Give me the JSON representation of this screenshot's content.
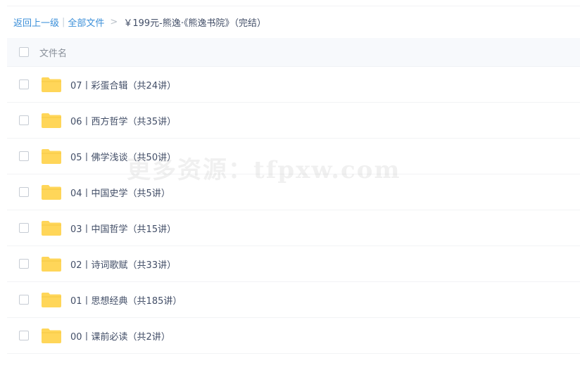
{
  "breadcrumb": {
    "back": "返回上一级",
    "divider": "|",
    "all_files": "全部文件",
    "separator": ">",
    "current": "￥199元-熊逸·《熊逸书院》（完结）"
  },
  "list_header": {
    "label": "文件名"
  },
  "files": [
    {
      "name": "07丨彩蛋合辑（共24讲）"
    },
    {
      "name": "06丨西方哲学（共35讲）"
    },
    {
      "name": "05丨佛学浅谈（共50讲）"
    },
    {
      "name": "04丨中国史学（共5讲）"
    },
    {
      "name": "03丨中国哲学（共15讲）"
    },
    {
      "name": "02丨诗词歌赋（共33讲）"
    },
    {
      "name": "01丨思想经典（共185讲）"
    },
    {
      "name": "00丨课前必读（共2讲）"
    }
  ],
  "watermark": "更多资源：tfpxw.com",
  "colors": {
    "link": "#3b8fd9",
    "text": "#424e67",
    "folder": "#ffd659"
  }
}
